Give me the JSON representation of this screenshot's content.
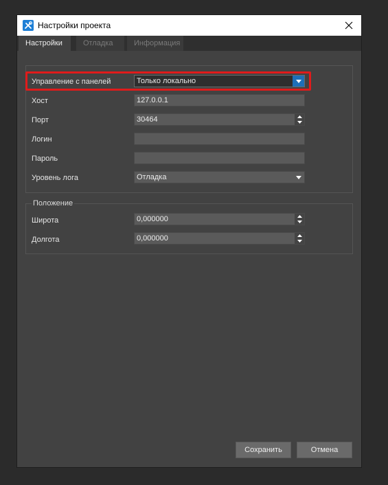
{
  "window": {
    "title": "Настройки проекта"
  },
  "tabs": [
    {
      "label": "Настройки",
      "active": true
    },
    {
      "label": "Отладка",
      "active": false
    },
    {
      "label": "Информация",
      "active": false
    }
  ],
  "connection": {
    "panel_control": {
      "label": "Управление с панелей",
      "value": "Только локально"
    },
    "host": {
      "label": "Хост",
      "value": "127.0.0.1"
    },
    "port": {
      "label": "Порт",
      "value": "30464"
    },
    "login": {
      "label": "Логин",
      "value": ""
    },
    "password": {
      "label": "Пароль",
      "value": ""
    },
    "log_level": {
      "label": "Уровень лога",
      "value": "Отладка"
    }
  },
  "position": {
    "title": "Положение",
    "latitude": {
      "label": "Широта",
      "value": "0,000000"
    },
    "longitude": {
      "label": "Долгота",
      "value": "0,000000"
    }
  },
  "buttons": {
    "save": "Сохранить",
    "cancel": "Отмена"
  },
  "colors": {
    "highlight": "#e01b1b",
    "accent": "#1e6fb8",
    "background": "#424242"
  }
}
